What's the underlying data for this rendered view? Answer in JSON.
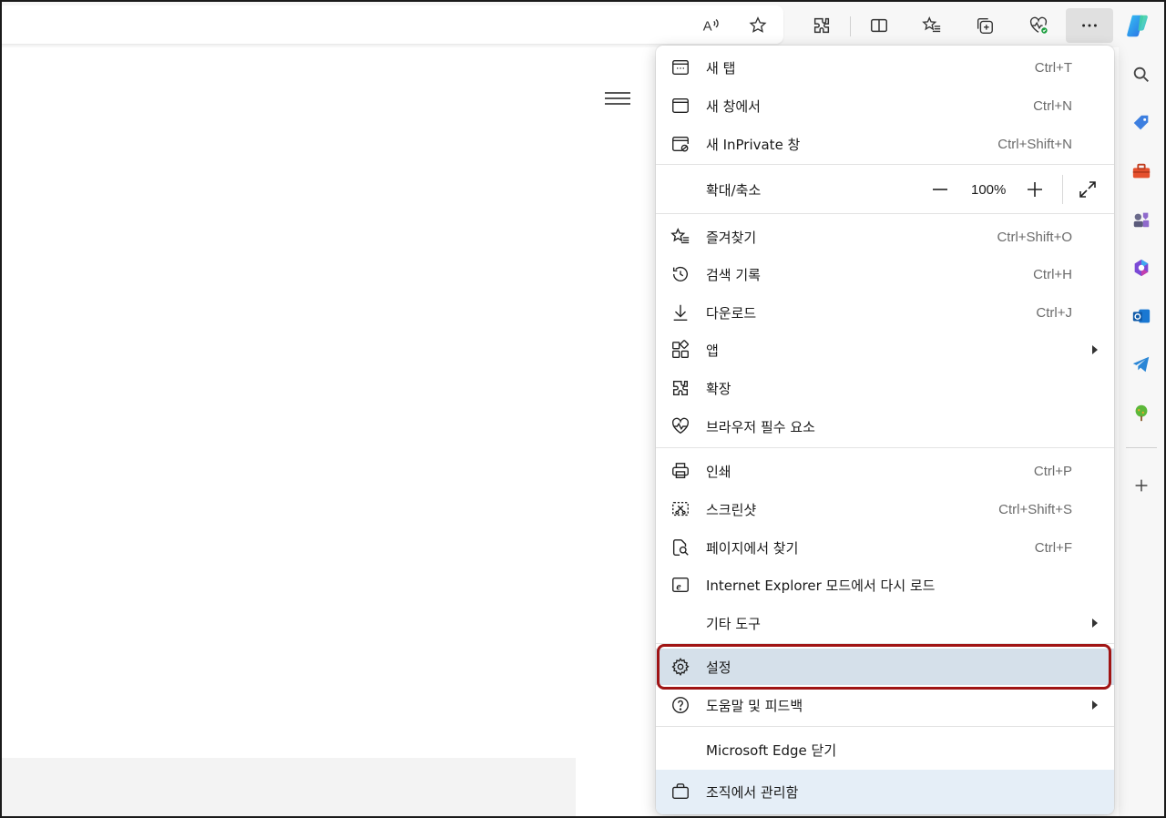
{
  "toolbar": {
    "icons": [
      "read-aloud-icon",
      "favorite-star-icon",
      "extensions-icon",
      "split-screen-icon",
      "favorites-icon",
      "collections-icon",
      "browser-essentials-icon",
      "more-icon",
      "copilot-icon"
    ]
  },
  "sidebar": {
    "items": [
      "search-icon",
      "shopping-icon",
      "tools-icon",
      "games-icon",
      "microsoft365-icon",
      "outlook-icon",
      "telegram-icon",
      "tree-icon",
      "add-icon"
    ]
  },
  "menu": {
    "new_tab": {
      "label": "새 탭",
      "shortcut": "Ctrl+T"
    },
    "new_window": {
      "label": "새 창에서",
      "shortcut": "Ctrl+N"
    },
    "inprivate": {
      "label": "새 InPrivate 창",
      "shortcut": "Ctrl+Shift+N"
    },
    "zoom": {
      "label": "확대/축소",
      "value": "100%"
    },
    "favorites": {
      "label": "즐겨찾기",
      "shortcut": "Ctrl+Shift+O"
    },
    "history": {
      "label": "검색 기록",
      "shortcut": "Ctrl+H"
    },
    "downloads": {
      "label": "다운로드",
      "shortcut": "Ctrl+J"
    },
    "apps": {
      "label": "앱"
    },
    "extensions": {
      "label": "확장"
    },
    "essentials": {
      "label": "브라우저 필수 요소"
    },
    "print": {
      "label": "인쇄",
      "shortcut": "Ctrl+P"
    },
    "screenshot": {
      "label": "스크린샷",
      "shortcut": "Ctrl+Shift+S"
    },
    "find": {
      "label": "페이지에서 찾기",
      "shortcut": "Ctrl+F"
    },
    "ie_mode": {
      "label": "Internet Explorer 모드에서 다시 로드"
    },
    "more_tools": {
      "label": "기타 도구"
    },
    "settings": {
      "label": "설정"
    },
    "help": {
      "label": "도움말 및 피드백"
    },
    "close_edge": {
      "label": "Microsoft Edge 닫기"
    },
    "managed": {
      "label": "조직에서 관리함"
    }
  },
  "colors": {
    "highlight_border": "#a01414",
    "settings_bg": "#d5e0ea",
    "managed_bg": "#e5eef7"
  }
}
